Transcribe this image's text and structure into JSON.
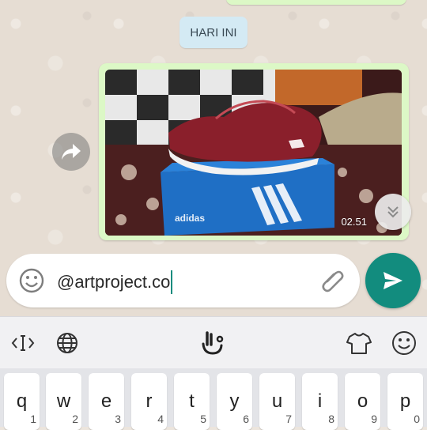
{
  "chat": {
    "date_label": "HARI INI",
    "message_time": "02.51"
  },
  "composer": {
    "input_value": "@artproject.co"
  },
  "keyboard": {
    "keys": [
      {
        "main": "q",
        "sub": "1"
      },
      {
        "main": "w",
        "sub": "2"
      },
      {
        "main": "e",
        "sub": "3"
      },
      {
        "main": "r",
        "sub": "4"
      },
      {
        "main": "t",
        "sub": "5"
      },
      {
        "main": "y",
        "sub": "6"
      },
      {
        "main": "u",
        "sub": "7"
      },
      {
        "main": "i",
        "sub": "8"
      },
      {
        "main": "o",
        "sub": "9"
      },
      {
        "main": "p",
        "sub": "0"
      }
    ]
  },
  "photo": {
    "box_brand_text": "adidas"
  },
  "colors": {
    "accent": "#128c7e",
    "outgoing_bubble": "#dcf8c6",
    "date_chip": "#d4eaf4"
  },
  "icons": [
    "forward-icon",
    "chevron-down-icon",
    "emoji-icon",
    "attach-icon",
    "send-icon",
    "cursor-icon",
    "globe-icon",
    "hand-icon",
    "shirt-icon",
    "smiley-icon"
  ]
}
